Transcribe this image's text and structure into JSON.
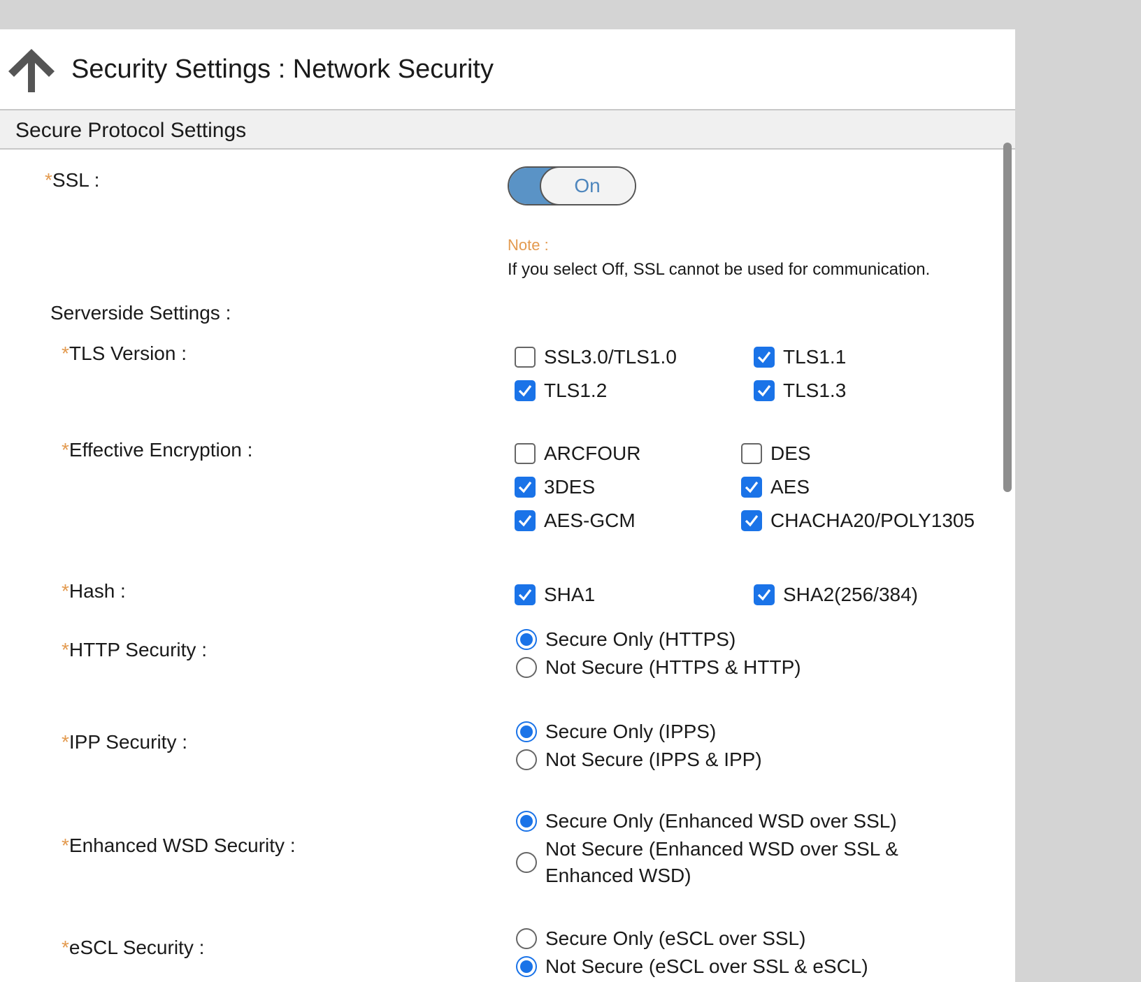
{
  "header": {
    "title": "Security Settings : Network Security"
  },
  "section": {
    "title": "Secure Protocol Settings"
  },
  "ssl": {
    "label": "SSL :",
    "toggle_state": "On"
  },
  "note": {
    "label": "Note :",
    "text": "If you select Off, SSL cannot be used for communication."
  },
  "serverside": {
    "label": "Serverside Settings :"
  },
  "tls_version": {
    "label": "TLS Version :",
    "options": [
      {
        "label": "SSL3.0/TLS1.0",
        "checked": false
      },
      {
        "label": "TLS1.1",
        "checked": true
      },
      {
        "label": "TLS1.2",
        "checked": true
      },
      {
        "label": "TLS1.3",
        "checked": true
      }
    ]
  },
  "encryption": {
    "label": "Effective Encryption :",
    "options": [
      {
        "label": "ARCFOUR",
        "checked": false
      },
      {
        "label": "DES",
        "checked": false
      },
      {
        "label": "3DES",
        "checked": true
      },
      {
        "label": "AES",
        "checked": true
      },
      {
        "label": "AES-GCM",
        "checked": true
      },
      {
        "label": "CHACHA20/POLY1305",
        "checked": true
      }
    ]
  },
  "hash": {
    "label": "Hash :",
    "options": [
      {
        "label": "SHA1",
        "checked": true
      },
      {
        "label": "SHA2(256/384)",
        "checked": true
      }
    ]
  },
  "http_security": {
    "label": "HTTP Security :",
    "options": [
      {
        "label": "Secure Only (HTTPS)",
        "selected": true
      },
      {
        "label": "Not Secure (HTTPS & HTTP)",
        "selected": false
      }
    ]
  },
  "ipp_security": {
    "label": "IPP Security :",
    "options": [
      {
        "label": "Secure Only (IPPS)",
        "selected": true
      },
      {
        "label": "Not Secure (IPPS & IPP)",
        "selected": false
      }
    ]
  },
  "wsd_security": {
    "label": "Enhanced WSD Security :",
    "options": [
      {
        "label": "Secure Only (Enhanced WSD over SSL)",
        "selected": true
      },
      {
        "label_line1": "Not Secure (Enhanced WSD over SSL &",
        "label_line2": "Enhanced WSD)",
        "selected": false
      }
    ]
  },
  "escl_security": {
    "label": "eSCL Security :",
    "options": [
      {
        "label": "Secure Only (eSCL over SSL)",
        "selected": false
      },
      {
        "label": "Not Secure (eSCL over SSL & eSCL)",
        "selected": true
      }
    ]
  },
  "asterisk": "*",
  "colors": {
    "accent": "#1a73e8",
    "toggle_fill": "#5a93c6",
    "note": "#e39a4f"
  }
}
